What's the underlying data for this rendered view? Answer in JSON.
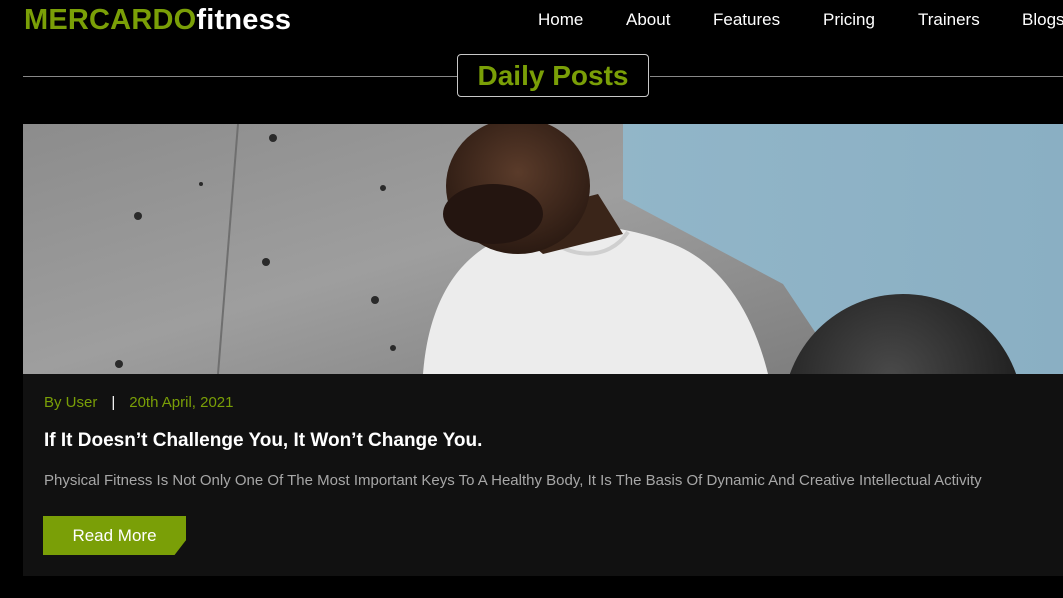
{
  "header": {
    "logo_brand": "MERCARDO",
    "logo_suffix": "fitness",
    "nav": [
      "Home",
      "About",
      "Features",
      "Pricing",
      "Trainers",
      "Blogs"
    ]
  },
  "section": {
    "title": "Daily Posts"
  },
  "post": {
    "author": "By User",
    "separator": "|",
    "date": "20th April, 2021",
    "title": "If It Doesn’t Challenge You, It Won’t Change You.",
    "excerpt": "Physical Fitness Is Not Only One Of The Most Important Keys To A Healthy Body, It Is The Basis Of Dynamic And Creative Intellectual Activity",
    "button_label": "Read More",
    "image": "man-in-white-tshirt-with-medicine-ball-photo"
  },
  "colors": {
    "accent": "#7a9f07",
    "background": "#000000",
    "card": "#111111",
    "text": "#ffffff",
    "muted": "#a7a7a7"
  }
}
